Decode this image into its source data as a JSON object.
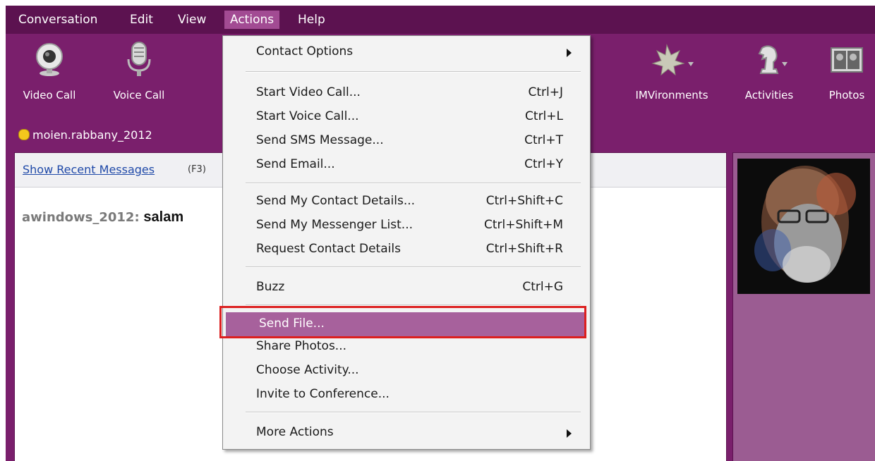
{
  "menubar": {
    "items": [
      "Conversation",
      "Edit",
      "View",
      "Actions",
      "Help"
    ],
    "active": "Actions"
  },
  "toolbar": {
    "video_call": "Video Call",
    "voice_call": "Voice Call",
    "imvironments": "IMVironments",
    "activities": "Activities",
    "photos": "Photos"
  },
  "contact": {
    "name": "moien.rabbany_2012",
    "status_color": "#f4c71d"
  },
  "chat": {
    "recent_link": "Show Recent Messages",
    "recent_hint": "(F3)",
    "message_from": "awindows_2012:",
    "message_text": "salam"
  },
  "actions_menu": {
    "contact_options": "Contact Options",
    "start_video_call": {
      "label": "Start Video Call...",
      "shortcut": "Ctrl+J"
    },
    "start_voice_call": {
      "label": "Start Voice Call...",
      "shortcut": "Ctrl+L"
    },
    "send_sms": {
      "label": "Send SMS Message...",
      "shortcut": "Ctrl+T"
    },
    "send_email": {
      "label": "Send Email...",
      "shortcut": "Ctrl+Y"
    },
    "send_contact_details": {
      "label": "Send My Contact Details...",
      "shortcut": "Ctrl+Shift+C"
    },
    "send_messenger_list": {
      "label": "Send My Messenger List...",
      "shortcut": "Ctrl+Shift+M"
    },
    "request_contact_details": {
      "label": "Request Contact Details",
      "shortcut": "Ctrl+Shift+R"
    },
    "buzz": {
      "label": "Buzz",
      "shortcut": "Ctrl+G"
    },
    "send_file": "Send File...",
    "share_photos": "Share Photos...",
    "choose_activity": "Choose Activity...",
    "invite_conference": "Invite to Conference...",
    "more_actions": "More Actions"
  },
  "colors": {
    "window": "#7a1f6c",
    "menubar": "#5c1250",
    "highlight": "#a7619c",
    "annotation": "#dc1f1f"
  }
}
